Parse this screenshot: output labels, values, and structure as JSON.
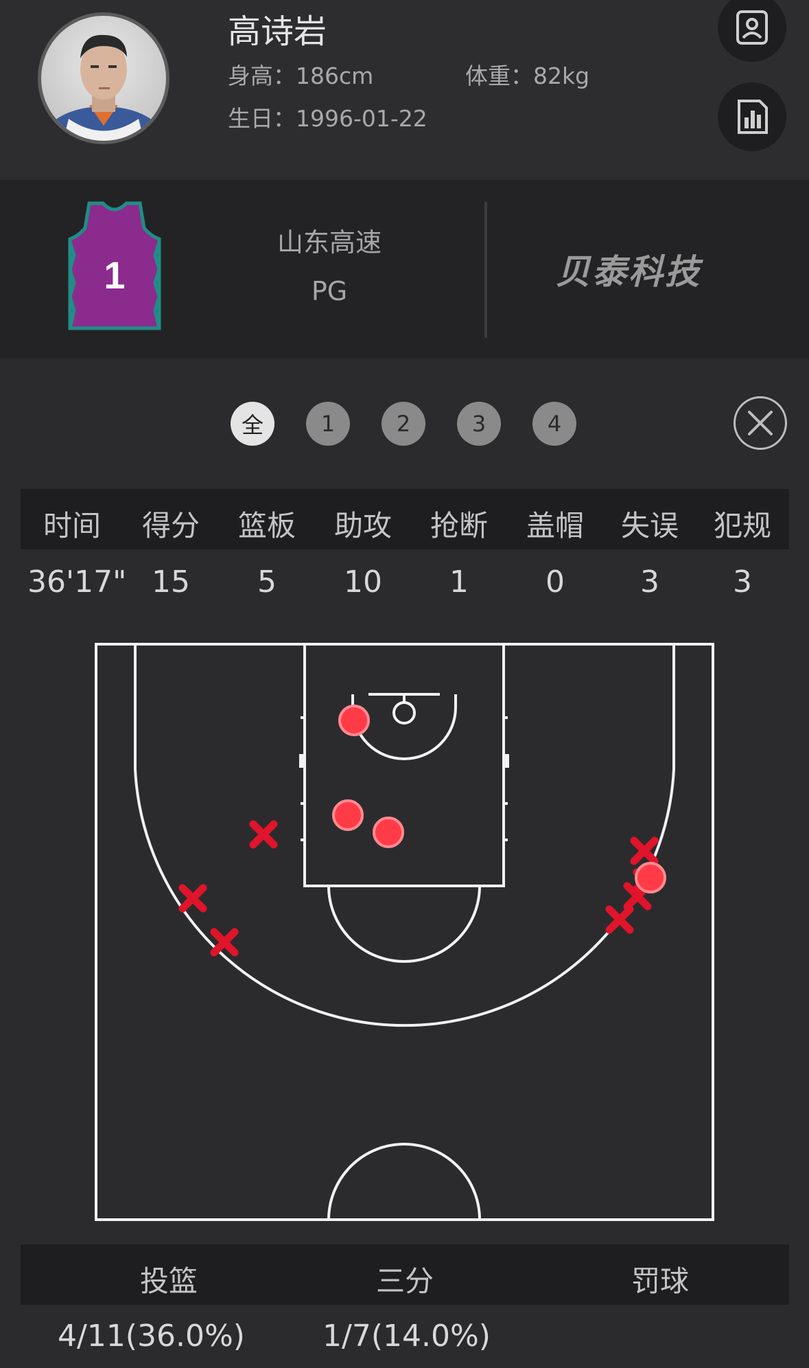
{
  "player": {
    "name": "高诗岩",
    "height": "身高：186cm",
    "weight": "体重：82kg",
    "birthday": "生日：1996-01-22"
  },
  "icons": {
    "profile": "profile-card-icon",
    "stats": "bar-chart-icon",
    "close": "close-icon"
  },
  "team": {
    "jersey_number": "1",
    "jersey_color": "#8b2b8e",
    "jersey_trim": "#1f8e86",
    "name": "山东高速",
    "position": "PG",
    "brand": "贝泰科技"
  },
  "quarter_tabs": [
    {
      "label": "全",
      "active": true
    },
    {
      "label": "1",
      "active": false
    },
    {
      "label": "2",
      "active": false
    },
    {
      "label": "3",
      "active": false
    },
    {
      "label": "4",
      "active": false
    }
  ],
  "stats": {
    "headers": [
      "时间",
      "得分",
      "篮板",
      "助攻",
      "抢断",
      "盖帽",
      "失误",
      "犯规"
    ],
    "values": [
      "36'17\"",
      "15",
      "5",
      "10",
      "1",
      "0",
      "3",
      "3"
    ]
  },
  "shot_chart": {
    "made_color": "#ff3b48",
    "missed_color": "#e0142a",
    "made_shots": 4,
    "missed_shots": 7
  },
  "shooting": {
    "headers": [
      "投篮",
      "三分",
      "罚球"
    ],
    "values": [
      "4/11(36.0%)",
      "1/7(14.0%)",
      ""
    ]
  }
}
